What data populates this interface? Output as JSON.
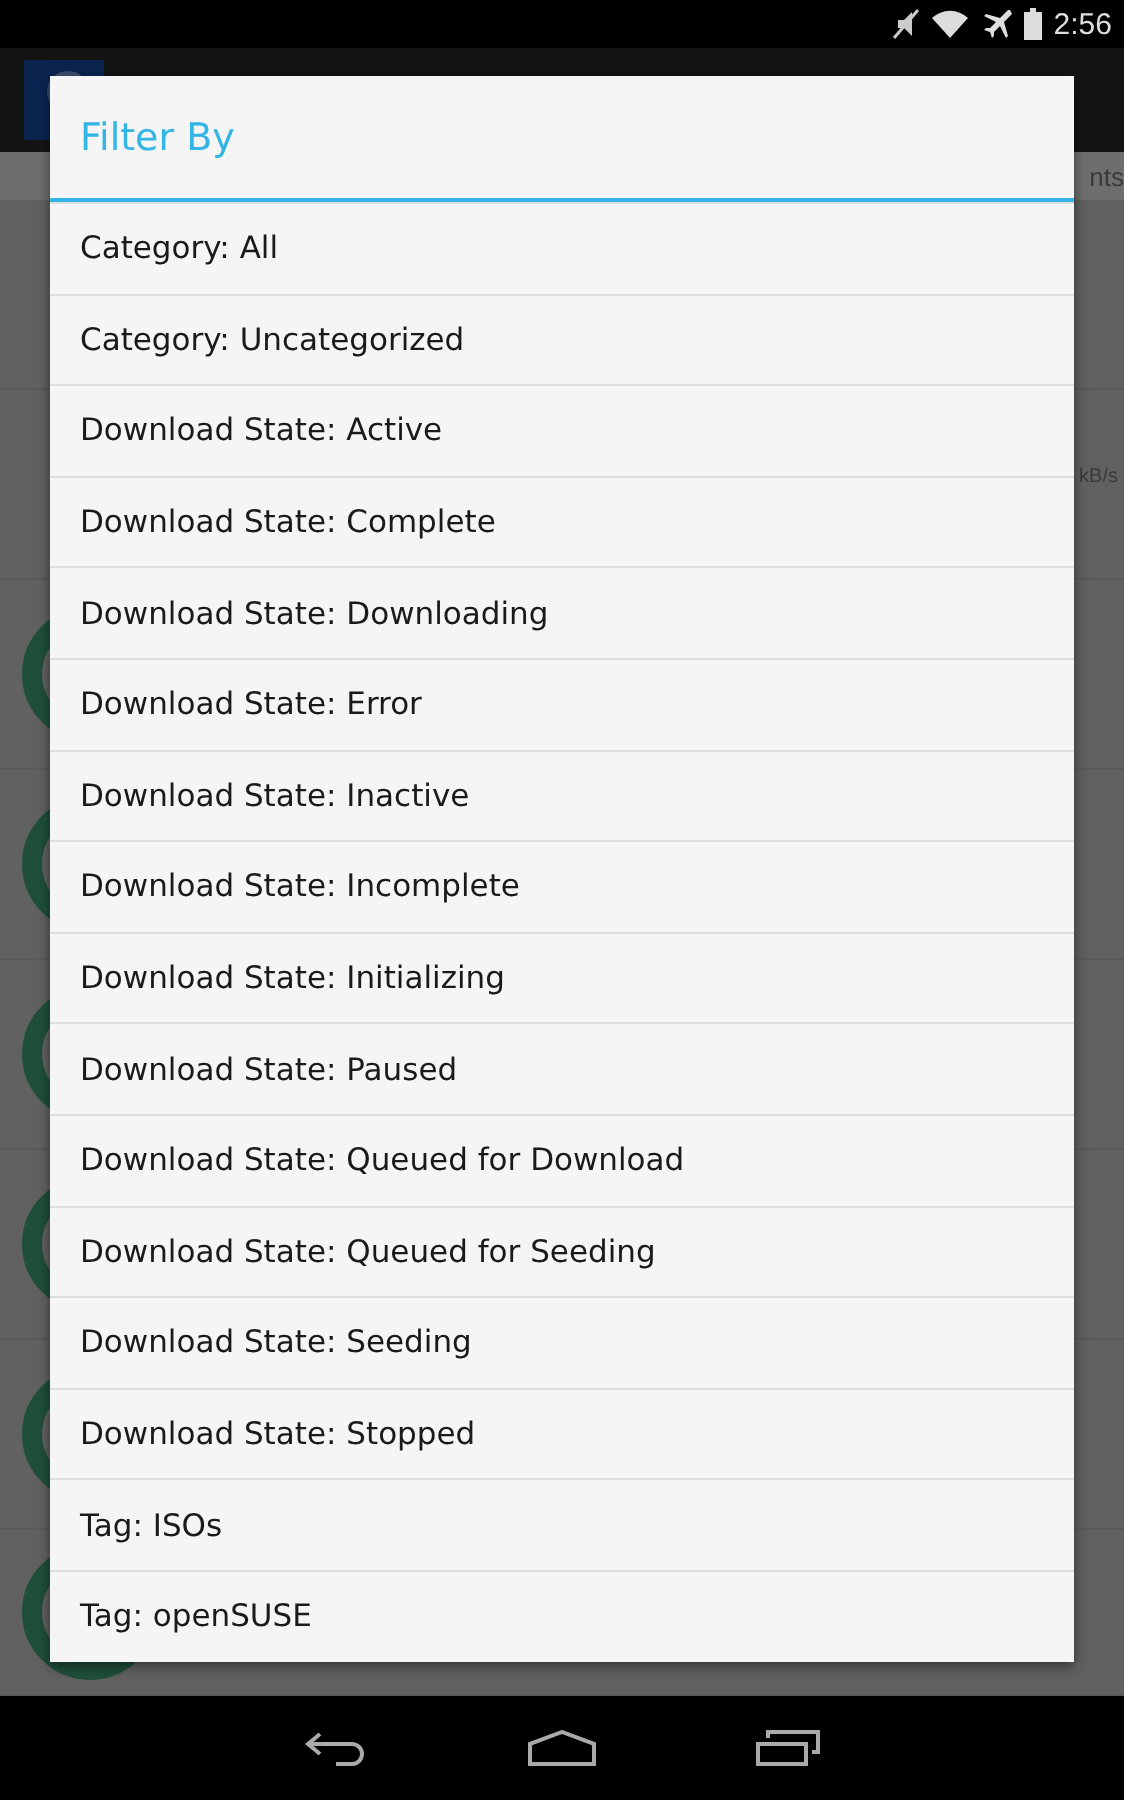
{
  "status_bar": {
    "time": "2:56"
  },
  "background": {
    "tab_fragment": "nts",
    "rows": [
      {
        "kind": "plain"
      },
      {
        "kind": "plain",
        "speed_fragment": "kB/s"
      },
      {
        "kind": "ring"
      },
      {
        "kind": "ring"
      },
      {
        "kind": "ring"
      },
      {
        "kind": "ring"
      },
      {
        "kind": "ring"
      },
      {
        "kind": "ring"
      }
    ]
  },
  "dialog": {
    "title": "Filter By",
    "items": [
      {
        "label": "Category: All"
      },
      {
        "label": "Category: Uncategorized"
      },
      {
        "label": "Download State: Active"
      },
      {
        "label": "Download State: Complete"
      },
      {
        "label": "Download State: Downloading"
      },
      {
        "label": "Download State: Error"
      },
      {
        "label": "Download State: Inactive"
      },
      {
        "label": "Download State: Incomplete"
      },
      {
        "label": "Download State: Initializing"
      },
      {
        "label": "Download State: Paused"
      },
      {
        "label": "Download State: Queued for Download"
      },
      {
        "label": "Download State: Queued for Seeding"
      },
      {
        "label": "Download State: Seeding"
      },
      {
        "label": "Download State: Stopped"
      },
      {
        "label": "Tag: ISOs"
      },
      {
        "label": "Tag: openSUSE"
      }
    ]
  }
}
